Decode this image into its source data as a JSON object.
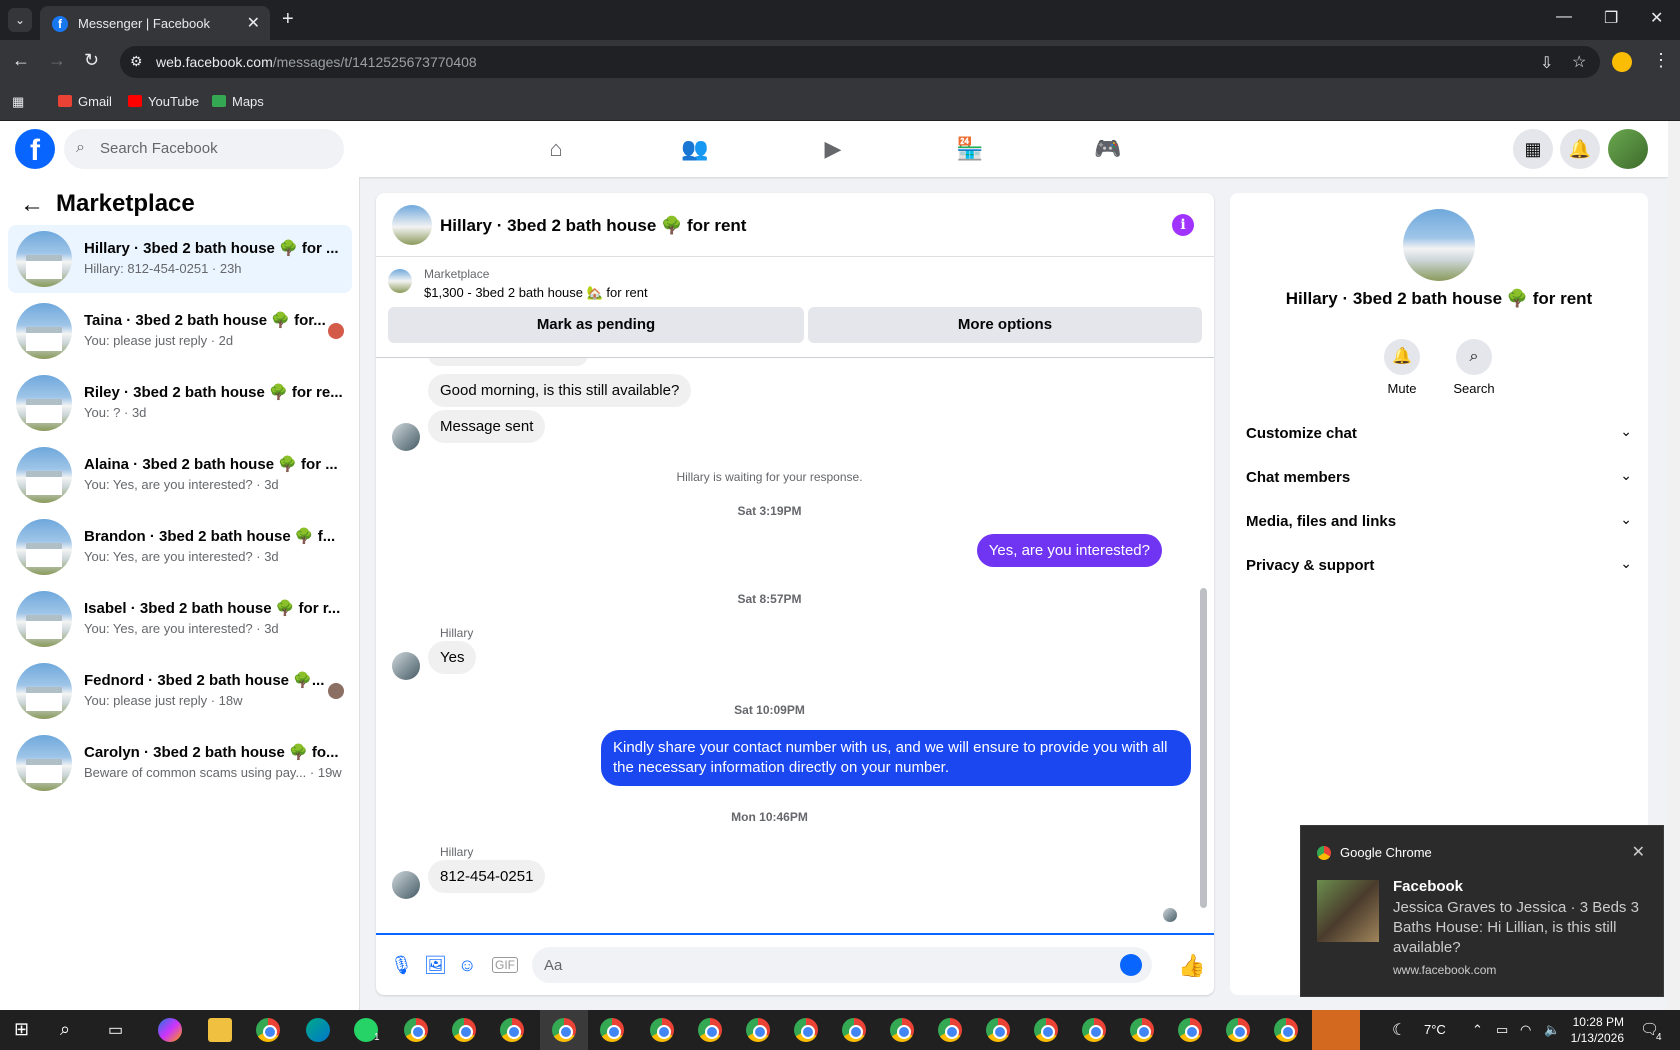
{
  "browser": {
    "tab_title": "Messenger | Facebook",
    "url_host": "web.facebook.com",
    "url_path": "/messages/t/1412525673770408",
    "bookmarks": [
      "Gmail",
      "YouTube",
      "Maps"
    ]
  },
  "fb": {
    "search_placeholder": "Search Facebook",
    "nav_icons": [
      "home-icon",
      "friends-icon",
      "video-icon",
      "marketplace-icon",
      "gaming-icon"
    ]
  },
  "left": {
    "title": "Marketplace",
    "conversations": [
      {
        "name": "Hillary · 3bed 2 bath house 🌳 for ...",
        "sub": "Hillary: 812-454-0251 · 23h",
        "active": true
      },
      {
        "name": "Taina · 3bed 2 bath house 🌳 for...",
        "sub": "You: please just reply · 2d"
      },
      {
        "name": "Riley · 3bed 2 bath house 🌳 for re...",
        "sub": "You: ? · 3d"
      },
      {
        "name": "Alaina · 3bed 2 bath house 🌳 for ...",
        "sub": "You: Yes, are you interested? · 3d"
      },
      {
        "name": "Brandon · 3bed 2 bath house 🌳 f...",
        "sub": "You: Yes, are you interested? · 3d"
      },
      {
        "name": "Isabel · 3bed 2 bath house 🌳 for r...",
        "sub": "You: Yes, are you interested? · 3d"
      },
      {
        "name": "Fednord · 3bed 2 bath house 🌳...",
        "sub": "You: please just reply · 18w"
      },
      {
        "name": "Carolyn · 3bed 2 bath house 🌳 fo...",
        "sub": "Beware of common scams using pay... · 19w"
      }
    ]
  },
  "chat": {
    "title": "Hillary · 3bed 2 bath house 🌳 for rent",
    "listing_label": "Marketplace",
    "listing_price": "$1,300 - 3bed 2 bath house 🏡 for rent",
    "btn_pending": "Mark as pending",
    "btn_more": "More options",
    "msg_1": "Good morning, is this still available?",
    "msg_2": "Message sent",
    "waiting_note": "Hillary is waiting for your response.",
    "ts_1": "Sat 3:19PM",
    "msg_3": "Yes, are you interested?",
    "ts_2": "Sat 8:57PM",
    "sender_1": "Hillary",
    "msg_4": "Yes",
    "ts_3": "Sat 10:09PM",
    "msg_5": "Kindly share your contact number with us, and we will ensure to provide you with all the necessary information directly on your number.",
    "ts_4": "Mon 10:46PM",
    "sender_2": "Hillary",
    "msg_6": "812-454-0251",
    "composer_placeholder": "Aa"
  },
  "right": {
    "name": "Hillary · 3bed 2 bath house 🌳 for rent",
    "mute_label": "Mute",
    "search_label": "Search",
    "sections": [
      "Customize chat",
      "Chat members",
      "Media, files and links",
      "Privacy & support"
    ]
  },
  "notification": {
    "app": "Google Chrome",
    "title": "Facebook",
    "body": "Jessica Graves to Jessica · 3 Beds 3 Baths House: Hi Lillian, is this still available?",
    "source": "www.facebook.com"
  },
  "taskbar": {
    "temperature": "7°C",
    "time": "10:28 PM",
    "date": "1/13/2026",
    "whatsapp_badge": "1",
    "notif_count": "4"
  },
  "colors": {
    "fb_blue": "#0866ff",
    "my_bubble": "#7034f3",
    "info_purple": "#a033ff"
  }
}
